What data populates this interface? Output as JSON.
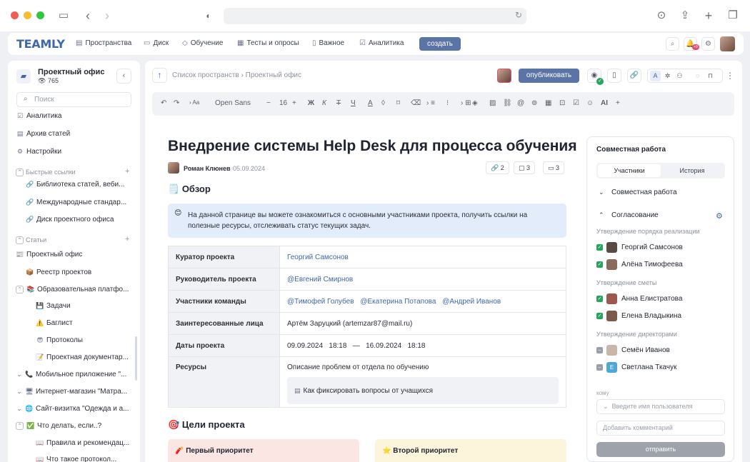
{
  "topnav": {
    "logo": "TEAMLY",
    "items": [
      {
        "label": "Пространства",
        "icon": "spaces-icon"
      },
      {
        "label": "Диск",
        "icon": "folder-icon"
      },
      {
        "label": "Обучение",
        "icon": "graduation-icon"
      },
      {
        "label": "Тесты и опросы",
        "icon": "survey-icon"
      },
      {
        "label": "Важное",
        "icon": "bookmark-icon"
      },
      {
        "label": "Аналитика",
        "icon": "analytics-icon"
      }
    ],
    "create_label": "создать",
    "notification_count": "+9"
  },
  "sidebar": {
    "title": "Проектный офис",
    "views": "765",
    "search_placeholder": "Поиск",
    "menu": [
      "Аналитика",
      "Архив статей",
      "Настройки"
    ],
    "quick_links_label": "Быстрые ссылки",
    "quick_links": [
      "Библиотека статей, веби...",
      "Международные стандар...",
      "Диск проектного офиса"
    ],
    "articles_label": "Статьи",
    "articles": [
      {
        "label": "Проектный офис",
        "icon": "📰"
      },
      {
        "label": "Реестр проектов",
        "icon": "📦"
      },
      {
        "label": "Образовательная платфо...",
        "icon": "📚"
      },
      {
        "label": "Задачи",
        "icon": "💾"
      },
      {
        "label": "Баглист",
        "icon": "⚠️"
      },
      {
        "label": "Протоколы",
        "icon": "😎"
      },
      {
        "label": "Проектная документар...",
        "icon": "📝"
      },
      {
        "label": "Мобильное приложение \"...",
        "icon": "📞"
      },
      {
        "label": "Интернет-магазин \"Матра...",
        "icon": "🖥"
      },
      {
        "label": "Сайт-визитка \"Одежда и а...",
        "icon": "🌐"
      },
      {
        "label": "Что делать, если..?",
        "icon": "✅"
      },
      {
        "label": "Правила и рекомендац...",
        "icon": "📖"
      },
      {
        "label": "Что такое протокол...",
        "icon": "📖"
      }
    ]
  },
  "header": {
    "breadcrumb_root": "Список пространств",
    "breadcrumb_sep": "›",
    "breadcrumb_current": "Проектный офис",
    "publish_label": "опубликовать"
  },
  "toolbar": {
    "font": "Open Sans",
    "size": "16"
  },
  "document": {
    "title": "Внедрение системы Help Desk для процесса обучения",
    "author": "Роман Клюнев",
    "date": "05.09.2024",
    "stats": {
      "links": "2",
      "pages": "3",
      "folders": "3"
    },
    "overview_title": "Обзор",
    "overview_emoji": "🗒️",
    "info_emoji": "😊",
    "info_text": "На данной странице вы можете ознакомиться с основными участниками проекта, получить ссылки на полезные ресурсы, отслеживать статус текущих задач.",
    "rows": [
      {
        "key": "Куратор проекта",
        "links": [
          "Георгий Самсонов"
        ]
      },
      {
        "key": "Руководитель проекта",
        "links": [
          "@Евгений Смирнов"
        ]
      },
      {
        "key": "Участники команды",
        "links": [
          "@Тимофей Голубев",
          "@Екатерина Потапова",
          "@Андрей Иванов"
        ]
      },
      {
        "key": "Заинтересованные лица",
        "text": "Артём Заруцкий (artemzar87@mail.ru)"
      },
      {
        "key": "Даты проекта",
        "text": "09.09.2024   18:18   —   16.09.2024   18:18"
      }
    ],
    "resources_key": "Ресурсы",
    "resources_text": "Описание проблем от отдела по обучению",
    "resources_card": "Как фиксировать вопросы от учащихся",
    "goals_title": "Цели проекта",
    "goals_emoji": "🎯",
    "priority1": "Первый приоритет",
    "priority1_emoji": "🧨",
    "priority2": "Второй приоритет",
    "priority2_emoji": "⭐"
  },
  "panel": {
    "title": "Совместная работа",
    "tab_participants": "Участники",
    "tab_history": "История",
    "collab_head": "Совместная работа",
    "approval_head": "Согласование",
    "groups": [
      {
        "label": "Утверждение порядка реализации",
        "people": [
          {
            "name": "Георгий Самсонов",
            "checked": true,
            "color": "#5a4a44"
          },
          {
            "name": "Алёна Тимофеева",
            "checked": true,
            "color": "#8a6a58"
          }
        ]
      },
      {
        "label": "Утверждение сметы",
        "people": [
          {
            "name": "Анна Елистратова",
            "checked": true,
            "color": "#9b5a4f"
          },
          {
            "name": "Елена Владыкина",
            "checked": true,
            "color": "#7a5a4a"
          }
        ]
      },
      {
        "label": "Утверждение директорами",
        "people": [
          {
            "name": "Семён Иванов",
            "checked": false,
            "color": "#c9b6a8"
          },
          {
            "name": "Светлана Ткачук",
            "checked": false,
            "color": "#4fa7d8",
            "initial": "E"
          }
        ]
      }
    ],
    "to_label": "кому",
    "user_placeholder": "Введите имя пользователя",
    "comment_placeholder": "Добавить комментарий",
    "send_label": "отправить"
  }
}
